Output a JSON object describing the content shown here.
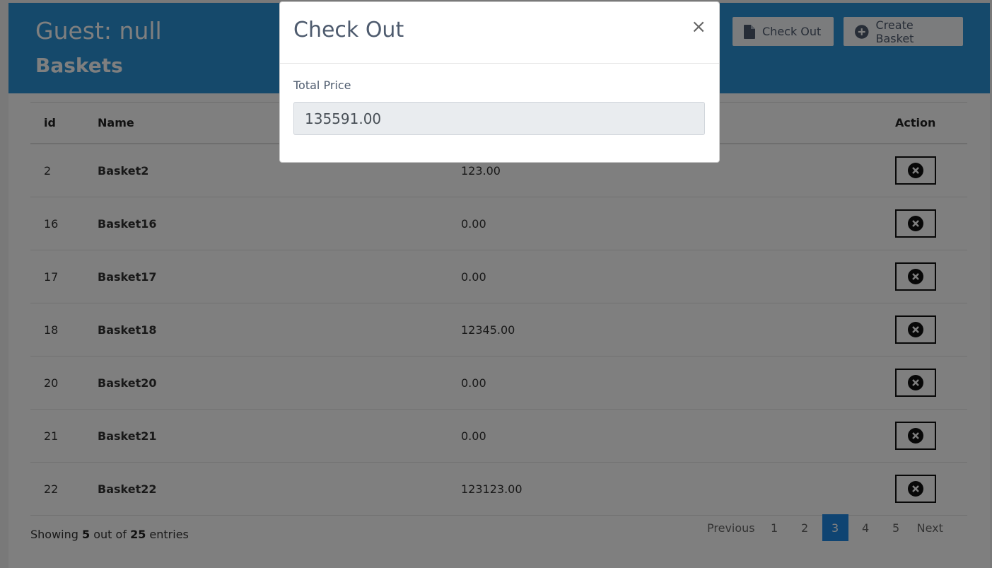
{
  "header": {
    "guest_label": "Guest: null",
    "section_title": "Baskets",
    "checkout_button": "Check Out",
    "create_button": "Create Basket"
  },
  "table": {
    "columns": [
      "id",
      "Name",
      "",
      "Action"
    ],
    "rows": [
      {
        "id": "2",
        "name": "Basket2",
        "price": "123.00"
      },
      {
        "id": "16",
        "name": "Basket16",
        "price": "0.00"
      },
      {
        "id": "17",
        "name": "Basket17",
        "price": "0.00"
      },
      {
        "id": "18",
        "name": "Basket18",
        "price": "12345.00"
      },
      {
        "id": "20",
        "name": "Basket20",
        "price": "0.00"
      },
      {
        "id": "21",
        "name": "Basket21",
        "price": "0.00"
      },
      {
        "id": "22",
        "name": "Basket22",
        "price": "123123.00"
      }
    ]
  },
  "footer": {
    "showing_prefix": "Showing",
    "showing_count": "5",
    "showing_mid": "out of",
    "showing_total": "25",
    "showing_suffix": "entries"
  },
  "pagination": {
    "previous": "Previous",
    "pages": [
      "1",
      "2",
      "3",
      "4",
      "5"
    ],
    "active": "3",
    "next": "Next"
  },
  "modal": {
    "title": "Check Out",
    "close": "×",
    "label": "Total Price",
    "value": "135591.00"
  },
  "colors": {
    "header_bg": "#2b93d6",
    "active_page": "#1e88e5"
  }
}
